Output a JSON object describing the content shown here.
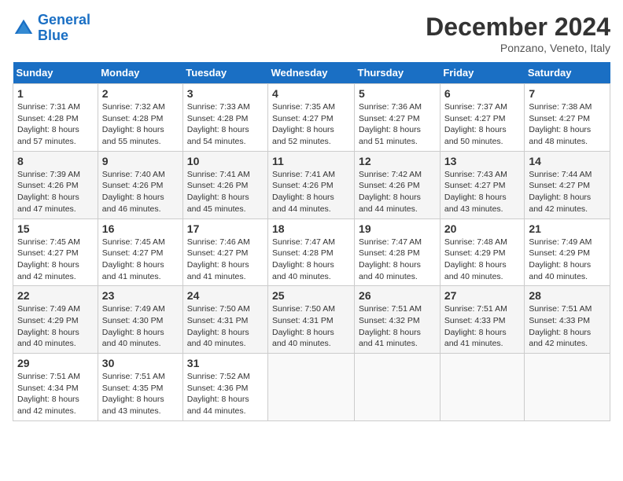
{
  "logo": {
    "line1": "General",
    "line2": "Blue"
  },
  "title": "December 2024",
  "location": "Ponzano, Veneto, Italy",
  "days_of_week": [
    "Sunday",
    "Monday",
    "Tuesday",
    "Wednesday",
    "Thursday",
    "Friday",
    "Saturday"
  ],
  "weeks": [
    [
      {
        "day": 1,
        "sunrise": "Sunrise: 7:31 AM",
        "sunset": "Sunset: 4:28 PM",
        "daylight": "Daylight: 8 hours and 57 minutes."
      },
      {
        "day": 2,
        "sunrise": "Sunrise: 7:32 AM",
        "sunset": "Sunset: 4:28 PM",
        "daylight": "Daylight: 8 hours and 55 minutes."
      },
      {
        "day": 3,
        "sunrise": "Sunrise: 7:33 AM",
        "sunset": "Sunset: 4:28 PM",
        "daylight": "Daylight: 8 hours and 54 minutes."
      },
      {
        "day": 4,
        "sunrise": "Sunrise: 7:35 AM",
        "sunset": "Sunset: 4:27 PM",
        "daylight": "Daylight: 8 hours and 52 minutes."
      },
      {
        "day": 5,
        "sunrise": "Sunrise: 7:36 AM",
        "sunset": "Sunset: 4:27 PM",
        "daylight": "Daylight: 8 hours and 51 minutes."
      },
      {
        "day": 6,
        "sunrise": "Sunrise: 7:37 AM",
        "sunset": "Sunset: 4:27 PM",
        "daylight": "Daylight: 8 hours and 50 minutes."
      },
      {
        "day": 7,
        "sunrise": "Sunrise: 7:38 AM",
        "sunset": "Sunset: 4:27 PM",
        "daylight": "Daylight: 8 hours and 48 minutes."
      }
    ],
    [
      {
        "day": 8,
        "sunrise": "Sunrise: 7:39 AM",
        "sunset": "Sunset: 4:26 PM",
        "daylight": "Daylight: 8 hours and 47 minutes."
      },
      {
        "day": 9,
        "sunrise": "Sunrise: 7:40 AM",
        "sunset": "Sunset: 4:26 PM",
        "daylight": "Daylight: 8 hours and 46 minutes."
      },
      {
        "day": 10,
        "sunrise": "Sunrise: 7:41 AM",
        "sunset": "Sunset: 4:26 PM",
        "daylight": "Daylight: 8 hours and 45 minutes."
      },
      {
        "day": 11,
        "sunrise": "Sunrise: 7:41 AM",
        "sunset": "Sunset: 4:26 PM",
        "daylight": "Daylight: 8 hours and 44 minutes."
      },
      {
        "day": 12,
        "sunrise": "Sunrise: 7:42 AM",
        "sunset": "Sunset: 4:26 PM",
        "daylight": "Daylight: 8 hours and 44 minutes."
      },
      {
        "day": 13,
        "sunrise": "Sunrise: 7:43 AM",
        "sunset": "Sunset: 4:27 PM",
        "daylight": "Daylight: 8 hours and 43 minutes."
      },
      {
        "day": 14,
        "sunrise": "Sunrise: 7:44 AM",
        "sunset": "Sunset: 4:27 PM",
        "daylight": "Daylight: 8 hours and 42 minutes."
      }
    ],
    [
      {
        "day": 15,
        "sunrise": "Sunrise: 7:45 AM",
        "sunset": "Sunset: 4:27 PM",
        "daylight": "Daylight: 8 hours and 42 minutes."
      },
      {
        "day": 16,
        "sunrise": "Sunrise: 7:45 AM",
        "sunset": "Sunset: 4:27 PM",
        "daylight": "Daylight: 8 hours and 41 minutes."
      },
      {
        "day": 17,
        "sunrise": "Sunrise: 7:46 AM",
        "sunset": "Sunset: 4:27 PM",
        "daylight": "Daylight: 8 hours and 41 minutes."
      },
      {
        "day": 18,
        "sunrise": "Sunrise: 7:47 AM",
        "sunset": "Sunset: 4:28 PM",
        "daylight": "Daylight: 8 hours and 40 minutes."
      },
      {
        "day": 19,
        "sunrise": "Sunrise: 7:47 AM",
        "sunset": "Sunset: 4:28 PM",
        "daylight": "Daylight: 8 hours and 40 minutes."
      },
      {
        "day": 20,
        "sunrise": "Sunrise: 7:48 AM",
        "sunset": "Sunset: 4:29 PM",
        "daylight": "Daylight: 8 hours and 40 minutes."
      },
      {
        "day": 21,
        "sunrise": "Sunrise: 7:49 AM",
        "sunset": "Sunset: 4:29 PM",
        "daylight": "Daylight: 8 hours and 40 minutes."
      }
    ],
    [
      {
        "day": 22,
        "sunrise": "Sunrise: 7:49 AM",
        "sunset": "Sunset: 4:29 PM",
        "daylight": "Daylight: 8 hours and 40 minutes."
      },
      {
        "day": 23,
        "sunrise": "Sunrise: 7:49 AM",
        "sunset": "Sunset: 4:30 PM",
        "daylight": "Daylight: 8 hours and 40 minutes."
      },
      {
        "day": 24,
        "sunrise": "Sunrise: 7:50 AM",
        "sunset": "Sunset: 4:31 PM",
        "daylight": "Daylight: 8 hours and 40 minutes."
      },
      {
        "day": 25,
        "sunrise": "Sunrise: 7:50 AM",
        "sunset": "Sunset: 4:31 PM",
        "daylight": "Daylight: 8 hours and 40 minutes."
      },
      {
        "day": 26,
        "sunrise": "Sunrise: 7:51 AM",
        "sunset": "Sunset: 4:32 PM",
        "daylight": "Daylight: 8 hours and 41 minutes."
      },
      {
        "day": 27,
        "sunrise": "Sunrise: 7:51 AM",
        "sunset": "Sunset: 4:33 PM",
        "daylight": "Daylight: 8 hours and 41 minutes."
      },
      {
        "day": 28,
        "sunrise": "Sunrise: 7:51 AM",
        "sunset": "Sunset: 4:33 PM",
        "daylight": "Daylight: 8 hours and 42 minutes."
      }
    ],
    [
      {
        "day": 29,
        "sunrise": "Sunrise: 7:51 AM",
        "sunset": "Sunset: 4:34 PM",
        "daylight": "Daylight: 8 hours and 42 minutes."
      },
      {
        "day": 30,
        "sunrise": "Sunrise: 7:51 AM",
        "sunset": "Sunset: 4:35 PM",
        "daylight": "Daylight: 8 hours and 43 minutes."
      },
      {
        "day": 31,
        "sunrise": "Sunrise: 7:52 AM",
        "sunset": "Sunset: 4:36 PM",
        "daylight": "Daylight: 8 hours and 44 minutes."
      },
      null,
      null,
      null,
      null
    ]
  ]
}
